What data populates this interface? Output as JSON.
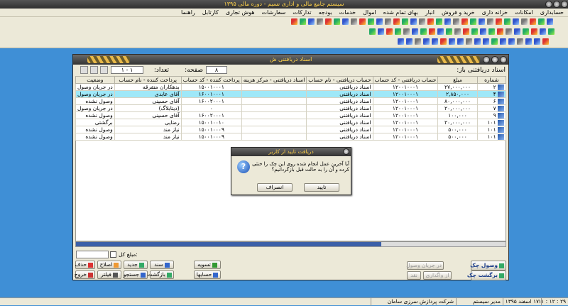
{
  "app": {
    "title": "سیستم جامع مالی و اداری نسیم - دوره مالی ۱۳۹۵"
  },
  "menu": [
    "حسابداری",
    "امکانات",
    "خزانه داری",
    "خرید و فروش",
    "انبار",
    "بهای تمام شده",
    "اموال",
    "خدمات",
    "بودجه",
    "تدارکات",
    "سفارشات",
    "هوش تجاری",
    "کارتابل",
    "راهنما"
  ],
  "window": {
    "title": "اسناد دریافتنی ش",
    "header": {
      "status_label": "اسناد دریافتنی باز:",
      "count_label": "تعداد:",
      "count_value": "۸",
      "page_label": "صفحه:",
      "page_value": "۱ - ۱"
    },
    "columns": [
      "شماره",
      "مبلغ",
      "حساب دریافتنی - کد حساب",
      "حساب دریافتنی - نام حساب",
      "اسناد دریافتنی - مرکز هزینه",
      "پرداخت کننده - کد حساب",
      "پرداخت کننده - نام حساب",
      "وضعیت"
    ],
    "rows": [
      {
        "num": "۲",
        "amount": "۲۷,۰۰۰,۰۰۰",
        "code": "۱۲۰۰۱۰۰۰۱",
        "name": "اسناد دریافتنی",
        "cost": "",
        "payer_code": "۱۵۰۰۱۰۰۰۱",
        "payer_name": "بدهکاران متفرقه",
        "status": "در جریان وصول",
        "selected": false
      },
      {
        "num": "۴",
        "amount": "۲,۸۵۰,۰۰۰",
        "code": "۱۲۰۰۱۰۰۰۱",
        "name": "اسناد دریافتنی",
        "cost": "",
        "payer_code": "۱۶۰۰۱۰۰۰۱",
        "payer_name": "آقای عابدی",
        "status": "در جریان وصول",
        "selected": true
      },
      {
        "num": "۶",
        "amount": "۸۰,۰۰۰,۰۰۰",
        "code": "۱۲۰۰۱۰۰۰۱",
        "name": "اسناد دریافتنی",
        "cost": "",
        "payer_code": "۱۶۰۰۲۰۰۰۱",
        "payer_name": "آقای حسینی",
        "status": "وصول نشده",
        "selected": false
      },
      {
        "num": "۷",
        "amount": "۲۰,۰۰۰,۰۰۰",
        "code": "۱۲۰۰۱۰۰۰۱",
        "name": "اسناد دریافتنی",
        "cost": "",
        "payer_code": "۰",
        "payer_name": "(دیتابلاگ)",
        "status": "در جریان وصول",
        "selected": false
      },
      {
        "num": "۹",
        "amount": "۱۰۰,۰۰۰",
        "code": "۱۲۰۰۱۰۰۰۱",
        "name": "اسناد دریافتنی",
        "cost": "",
        "payer_code": "۱۶۰۰۲۰۰۰۱",
        "payer_name": "آقای حسینی",
        "status": "وصول نشده",
        "selected": false
      },
      {
        "num": "۱۰۱",
        "amount": "۲۰,۰۰۰,۰۰۰",
        "code": "۱۲۰۰۱۰۰۰۱",
        "name": "اسناد دریافتنی",
        "cost": "",
        "payer_code": "۱۵۰۰۱۰۰۱۰",
        "payer_name": "رضایی",
        "status": "برگشتی",
        "selected": false
      },
      {
        "num": "۱۰۱",
        "amount": "۵۰۰,۰۰۰",
        "code": "۱۲۰۰۱۰۰۰۱",
        "name": "اسناد دریافتنی",
        "cost": "",
        "payer_code": "۱۵۰۰۱۰۰۰۹",
        "payer_name": "نیاز مند",
        "status": "وصول نشده",
        "selected": false
      },
      {
        "num": "۱۰۱",
        "amount": "۵۰۰,۰۰۰",
        "code": "۱۲۰۰۱۰۰۰۱",
        "name": "اسناد دریافتنی",
        "cost": "",
        "payer_code": "۱۵۰۰۱۰۰۰۹",
        "payer_name": "نیاز مند",
        "status": "وصول نشده",
        "selected": false
      }
    ],
    "sum_label": "مبلغ کل:",
    "buttons": {
      "delete": "حذف",
      "edit": "اصلاح",
      "new": "جدید",
      "doc": "سند",
      "settle": "تسویه",
      "exit": "خروج",
      "filter": "فیلتر",
      "search": "جستجو",
      "back": "بازگشت",
      "accounts": "حسابها",
      "receive": "وصول چک",
      "return": "برگشت چک",
      "in_progress": "در جریان وصول",
      "to_bank": "از واگذاری",
      "cash": "نقد"
    }
  },
  "dialog": {
    "title": "دریافت تایید از کاربر",
    "message": "آیا آخرین عمل انجام شده روی این چک را خنثی کرده و آن را به حالت قبل بازگردانیم؟",
    "ok": "تایید",
    "cancel": "انصراف"
  },
  "status": {
    "time": "۲۹ : ۱۲ : ۱۱",
    "date": "۱۷ اسفند ۱۳۹۵",
    "user": "مدیر سیستم",
    "company": "شرکت پردازش سرزی سامان"
  }
}
